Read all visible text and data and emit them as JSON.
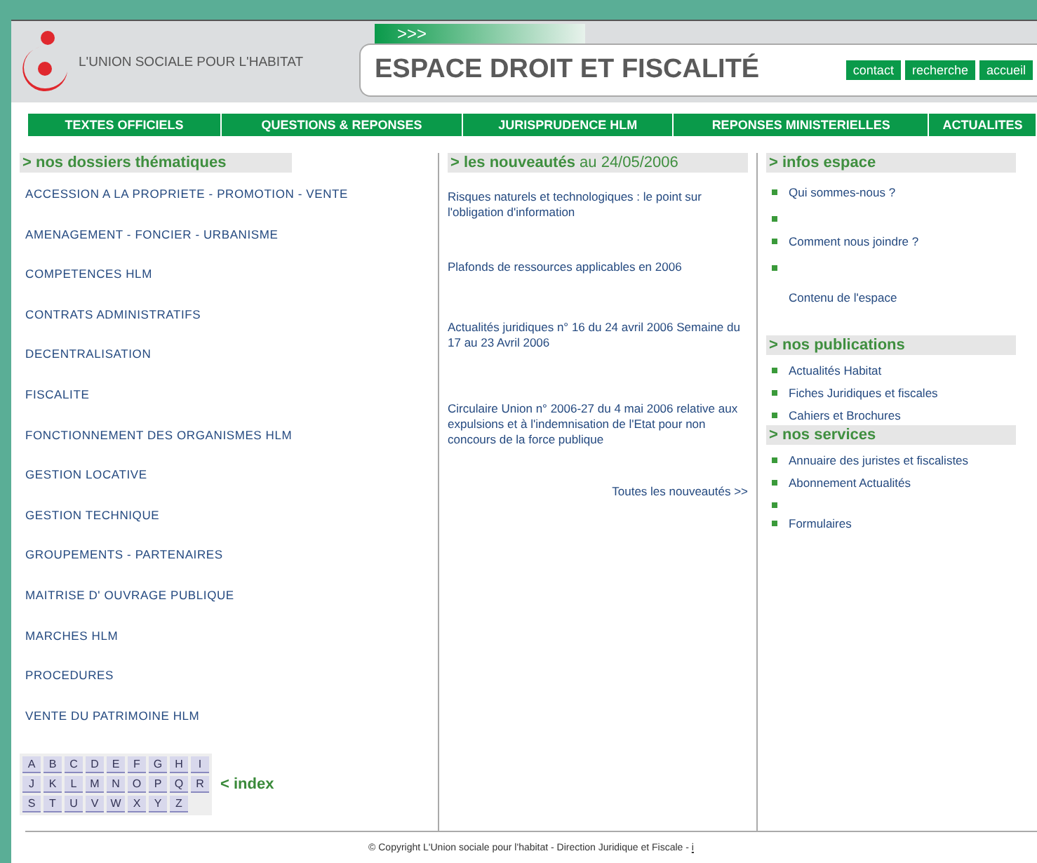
{
  "header": {
    "brand": "L'UNION SOCIALE POUR L'HABITAT",
    "tab": ">>>",
    "title": "ESPACE DROIT ET FISCALITÉ",
    "links": [
      "contact",
      "recherche",
      "accueil"
    ]
  },
  "nav": [
    "TEXTES OFFICIELS",
    "QUESTIONS & REPONSES",
    "JURISPRUDENCE HLM",
    "REPONSES MINISTERIELLES",
    "ACTUALITES"
  ],
  "dossiers": {
    "heading": "> nos dossiers thématiques",
    "items": [
      "ACCESSION A LA PROPRIETE - PROMOTION - VENTE",
      "AMENAGEMENT - FONCIER - URBANISME",
      "COMPETENCES HLM",
      "CONTRATS ADMINISTRATIFS",
      "DECENTRALISATION",
      "FISCALITE",
      "FONCTIONNEMENT DES ORGANISMES HLM",
      "GESTION LOCATIVE",
      "GESTION TECHNIQUE",
      "GROUPEMENTS - PARTENAIRES",
      "MAITRISE D' OUVRAGE PUBLIQUE",
      "MARCHES HLM",
      "PROCEDURES",
      "VENTE DU PATRIMOINE HLM"
    ],
    "index_letters": [
      "A",
      "B",
      "C",
      "D",
      "E",
      "F",
      "G",
      "H",
      "I",
      "J",
      "K",
      "L",
      "M",
      "N",
      "O",
      "P",
      "Q",
      "R",
      "S",
      "T",
      "U",
      "V",
      "W",
      "X",
      "Y",
      "Z"
    ],
    "index_label": "< index"
  },
  "nouveautes": {
    "heading": "> les nouveautés",
    "date": "au 24/05/2006",
    "items": [
      "Risques naturels et technologiques : le point sur l'obligation d'information",
      "Plafonds de ressources applicables en 2006",
      "Actualités juridiques n° 16 du 24 avril 2006 Semaine du 17 au 23 Avril 2006",
      "Circulaire Union n° 2006-27 du 4 mai 2006 relative aux expulsions et à l'indemnisation de l'Etat pour non concours de la force publique"
    ],
    "more": "Toutes les nouveautés >>"
  },
  "sections": [
    {
      "heading": "> infos espace",
      "items": [
        {
          "kind": "link",
          "label": "Qui sommes-nous ?"
        },
        {
          "kind": "bullet"
        },
        {
          "kind": "link",
          "label": "Comment nous joindre ?"
        },
        {
          "kind": "bullet"
        },
        {
          "kind": "plain",
          "label": "Contenu de l'espace"
        }
      ]
    },
    {
      "heading": "> nos publications",
      "items": [
        {
          "kind": "link",
          "label": "Actualités Habitat"
        },
        {
          "kind": "link",
          "label": "Fiches Juridiques et fiscales"
        },
        {
          "kind": "link",
          "label": "Cahiers et Brochures"
        }
      ]
    },
    {
      "heading": "> nos services",
      "items": [
        {
          "kind": "link",
          "label": "Annuaire des juristes et fiscalistes"
        },
        {
          "kind": "link",
          "label": "Abonnement Actualités"
        },
        {
          "kind": "bullet"
        },
        {
          "kind": "link",
          "label": "Formulaires"
        }
      ]
    }
  ],
  "footer": {
    "copyright": "© Copyright L'Union sociale pour l'habitat - Direction Juridique et Fiscale -",
    "info_link": "i"
  }
}
